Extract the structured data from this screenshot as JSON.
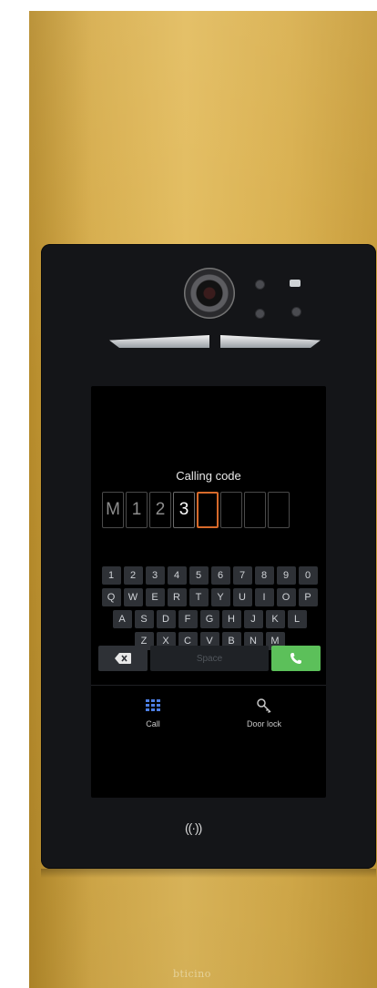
{
  "screen": {
    "title": "Calling code",
    "code_slots": [
      {
        "char": "M"
      },
      {
        "char": "1"
      },
      {
        "char": "2"
      },
      {
        "char": "3"
      },
      {
        "char": ""
      },
      {
        "char": ""
      },
      {
        "char": ""
      },
      {
        "char": ""
      }
    ],
    "keyboard": {
      "row1": [
        "1",
        "2",
        "3",
        "4",
        "5",
        "6",
        "7",
        "8",
        "9",
        "0"
      ],
      "row2": [
        "Q",
        "W",
        "E",
        "R",
        "T",
        "Y",
        "U",
        "I",
        "O",
        "P"
      ],
      "row3": [
        "A",
        "S",
        "D",
        "F",
        "G",
        "H",
        "J",
        "K",
        "L"
      ],
      "row4": [
        "Z",
        "X",
        "C",
        "V",
        "B",
        "N",
        "M"
      ],
      "space_label": "Space"
    },
    "nav": {
      "call_label": "Call",
      "door_lock_label": "Door lock"
    }
  },
  "device": {
    "brand": "bticino",
    "nfc_symbol": "((·))"
  },
  "icons": {
    "backspace": "backspace-icon",
    "call": "phone-icon",
    "grid": "grid-icon",
    "key": "key-icon",
    "nfc": "nfc-icon"
  },
  "colors": {
    "panel_gold": "#d6ac4a",
    "unit_black": "#141518",
    "active_slot": "#d76a2b",
    "call_green": "#5cc05a"
  }
}
